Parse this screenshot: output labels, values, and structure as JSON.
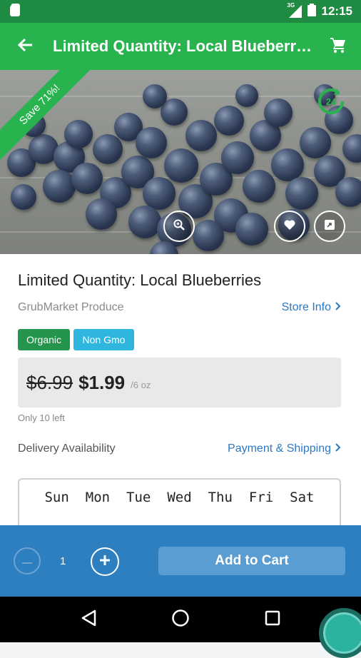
{
  "status_bar": {
    "network": "3G",
    "time": "12:15"
  },
  "app_bar": {
    "title": "Limited Quantity: Local Blueberr…"
  },
  "hero": {
    "ribbon": "Save 71%!",
    "badge": "24"
  },
  "product": {
    "title": "Limited Quantity: Local Blueberries",
    "vendor": "GrubMarket Produce",
    "store_link": "Store Info",
    "tags": [
      {
        "label": "Organic",
        "color": "#24954b"
      },
      {
        "label": "Non Gmo",
        "color": "#2fb6df"
      }
    ],
    "old_price": "$6.99",
    "price": "$1.99",
    "unit": "/6 oz",
    "stock": "Only 10 left",
    "delivery_label": "Delivery Availability",
    "payment_link": "Payment & Shipping",
    "days": [
      "Sun",
      "Mon",
      "Tue",
      "Wed",
      "Thu",
      "Fri",
      "Sat"
    ]
  },
  "footer": {
    "quantity": "1",
    "add_to_cart": "Add to Cart"
  },
  "colors": {
    "green": "#28b34e",
    "dark_green": "#1f8a41",
    "blue": "#2d7fc0",
    "link": "#2b77c4"
  },
  "icons": {
    "status": [
      "sim-card-icon",
      "signal-icon",
      "battery-icon"
    ],
    "app_bar": [
      "back-arrow-icon",
      "cart-icon"
    ],
    "hero": [
      "24-hour-icon",
      "zoom-icon",
      "heart-icon",
      "share-icon"
    ],
    "nav": [
      "back-triangle-icon",
      "home-circle-icon",
      "recents-square-icon"
    ]
  }
}
